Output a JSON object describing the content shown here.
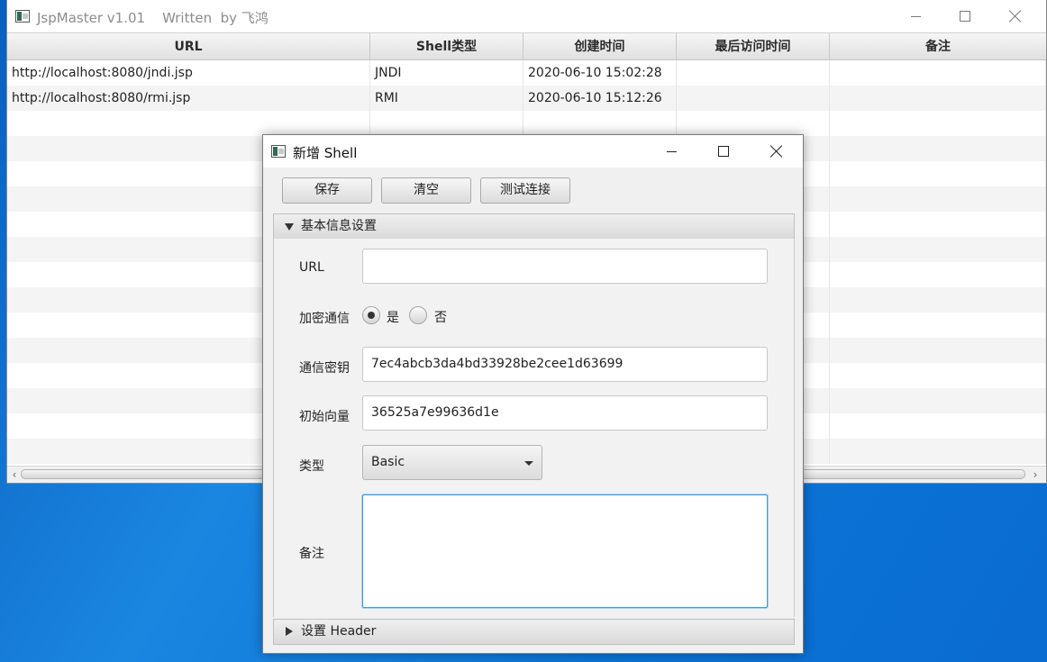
{
  "main": {
    "title": "JspMaster v1.01    Written  by 飞鸿",
    "columns": [
      "URL",
      "Shell类型",
      "创建时间",
      "最后访问时间",
      "备注"
    ],
    "rows": [
      {
        "url": "http://localhost:8080/jndi.jsp",
        "type": "JNDI",
        "created": "2020-06-10 15:02:28",
        "last_access": "",
        "note": ""
      },
      {
        "url": "http://localhost:8080/rmi.jsp",
        "type": "RMI",
        "created": "2020-06-10 15:12:26",
        "last_access": "",
        "note": ""
      }
    ],
    "icon": "app-window-icon"
  },
  "dialog": {
    "title": "新增 Shell",
    "buttons": {
      "save": "保存",
      "clear": "清空",
      "test": "测试连接"
    },
    "basic_section": "基本信息设置",
    "header_section": "设置 Header",
    "fields": {
      "url_label": "URL",
      "url_value": "",
      "encrypt_label": "加密通信",
      "encrypt_yes": "是",
      "encrypt_no": "否",
      "encrypt_selected": "是",
      "key_label": "通信密钥",
      "key_value": "7ec4abcb3da4bd33928be2cee1d63699",
      "iv_label": "初始向量",
      "iv_value": "36525a7e99636d1e",
      "type_label": "类型",
      "type_value": "Basic",
      "note_label": "备注",
      "note_value": ""
    }
  },
  "colors": {
    "accent_focus": "#3f9be0",
    "desktop": "#0b74d6"
  }
}
